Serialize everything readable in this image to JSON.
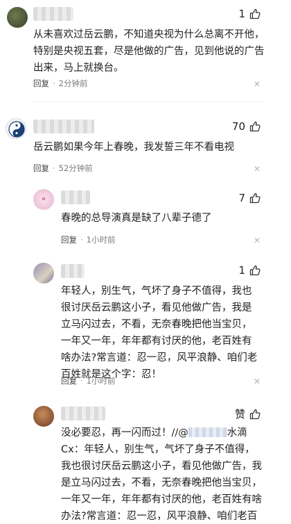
{
  "comments": [
    {
      "likes": "1",
      "text": "从未喜欢过岳云鹏，不知道央视为什么总离不开他，特别是央视五套，尽是他做的广告，见到他说的广告出来，马上就换台。",
      "reply_label": "回复",
      "time": "2分钟前"
    },
    {
      "likes": "70",
      "text": "岳云鹏如果今年上春晚，我发誓三年不看电视",
      "reply_label": "回复",
      "time": "52分钟前"
    },
    {
      "likes": "7",
      "text": "春晚的总导演真是缺了八辈子德了",
      "reply_label": "回复",
      "time": "1小时前"
    },
    {
      "likes": "1",
      "text": "年轻人，别生气，气坏了身子不值得，我也很讨厌岳云鹏这小子，看见他做广告，我是立马闪过去，不看，无奈春晚把他当宝贝，一年又一年，年年都有讨厌的他，老百姓有啥办法?常言道：忍一忍，风平浪静、咱们老百姓就是这个字：忍！",
      "reply_label": "回复",
      "time": "1小时前"
    },
    {
      "like_label": "赞",
      "text_start": "没必要忍，再一闪而过！//@",
      "text_mention_tail": "水滴C",
      "text_rest": "x：年轻人，别生气，气坏了身子不值得，我也很讨厌岳云鹏这小子，看见他做广告，我是立马闪过去，不看，无奈春晚把他当宝贝，一年又一年，年年都有讨厌的他，老百姓有啥办法?常言道：忍一忍，风平浪静、咱们老百姓就是这个字：忍！"
    }
  ],
  "icons": {
    "like": "thumbs-up-icon",
    "more": "close-icon"
  }
}
